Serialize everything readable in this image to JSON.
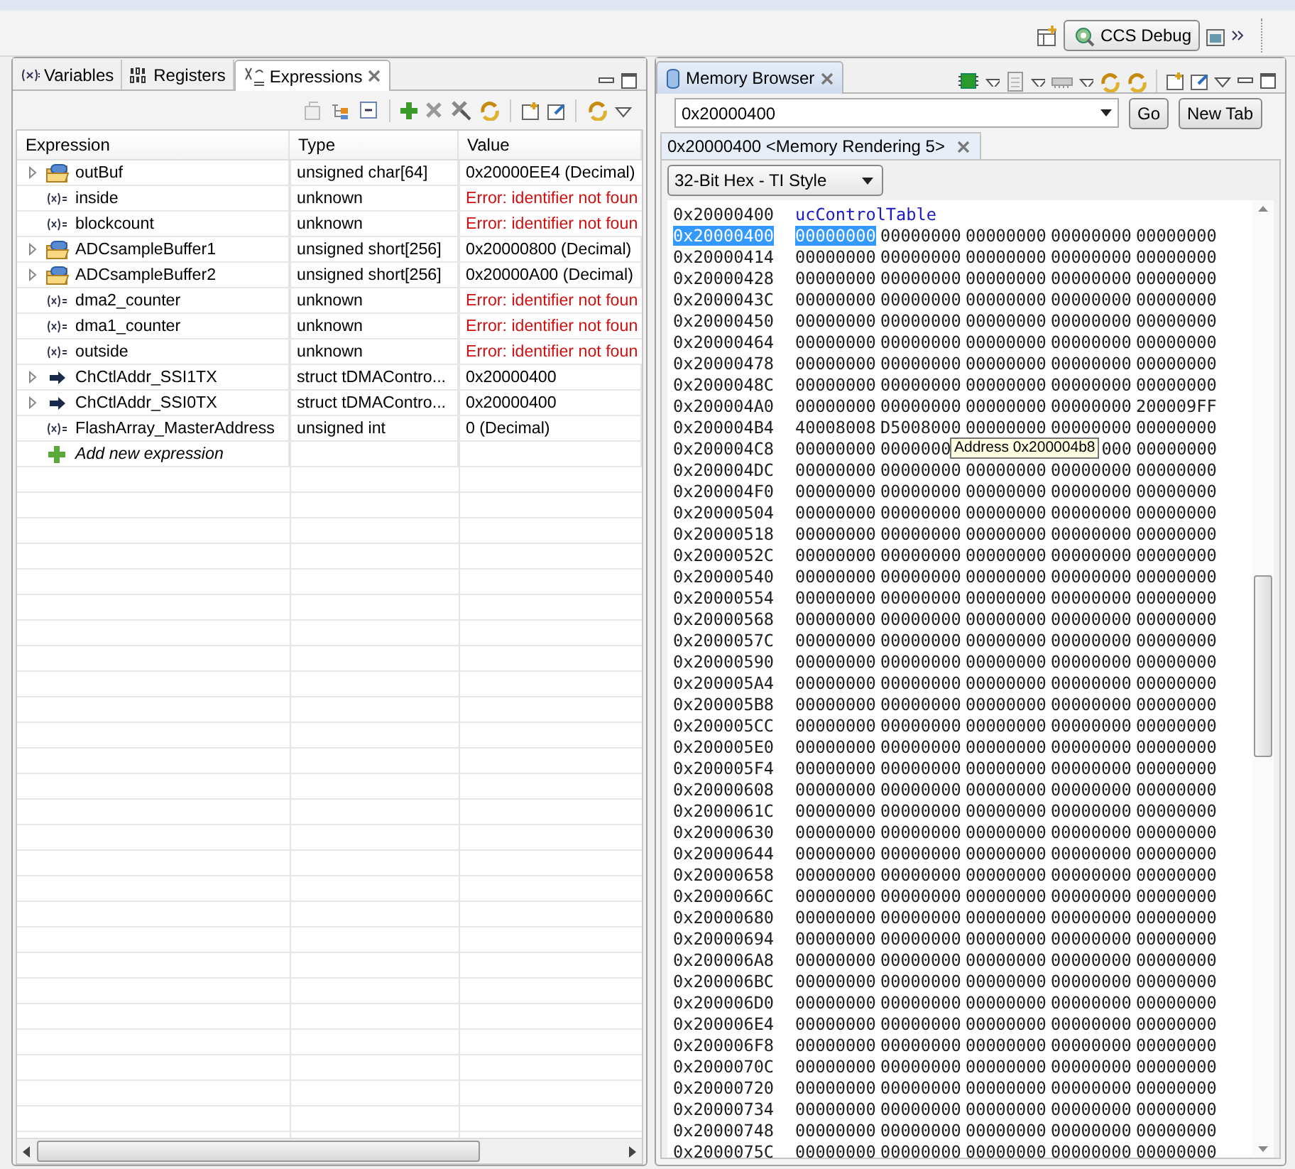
{
  "perspective_bar": {
    "perspectives": [
      {
        "label": "CCS Debug",
        "selected": true
      }
    ]
  },
  "expressions_view": {
    "tabs": [
      {
        "label": "Variables",
        "kind": "variables",
        "selected": false
      },
      {
        "label": "Registers",
        "kind": "registers",
        "selected": false
      },
      {
        "label": "Expressions",
        "kind": "expressions",
        "selected": true
      }
    ],
    "columns": [
      "Expression",
      "Type",
      "Value"
    ],
    "rows": [
      {
        "kind": "array",
        "expandable": true,
        "expression": "outBuf",
        "type": "unsigned char[64]",
        "value": "0x20000EE4 (Decimal)",
        "error": false
      },
      {
        "kind": "variable",
        "expandable": false,
        "expression": "inside",
        "type": "unknown",
        "value": "Error: identifier not foun",
        "error": true
      },
      {
        "kind": "variable",
        "expandable": false,
        "expression": "blockcount",
        "type": "unknown",
        "value": "Error: identifier not foun",
        "error": true
      },
      {
        "kind": "array",
        "expandable": true,
        "expression": "ADCsampleBuffer1",
        "type": "unsigned short[256]",
        "value": "0x20000800 (Decimal)",
        "error": false
      },
      {
        "kind": "array",
        "expandable": true,
        "expression": "ADCsampleBuffer2",
        "type": "unsigned short[256]",
        "value": "0x20000A00 (Decimal)",
        "error": false
      },
      {
        "kind": "variable",
        "expandable": false,
        "expression": "dma2_counter",
        "type": "unknown",
        "value": "Error: identifier not foun",
        "error": true
      },
      {
        "kind": "variable",
        "expandable": false,
        "expression": "dma1_counter",
        "type": "unknown",
        "value": "Error: identifier not foun",
        "error": true
      },
      {
        "kind": "variable",
        "expandable": false,
        "expression": "outside",
        "type": "unknown",
        "value": "Error: identifier not foun",
        "error": true
      },
      {
        "kind": "pointer",
        "expandable": true,
        "expression": "ChCtlAddr_SSI1TX",
        "type": "struct tDMAContro...",
        "value": "0x20000400",
        "error": false
      },
      {
        "kind": "pointer",
        "expandable": true,
        "expression": "ChCtlAddr_SSI0TX",
        "type": "struct tDMAContro...",
        "value": "0x20000400",
        "error": false
      },
      {
        "kind": "variable",
        "expandable": false,
        "expression": "FlashArray_MasterAddress",
        "type": "unsigned int",
        "value": "0 (Decimal)",
        "error": false
      },
      {
        "kind": "add",
        "expandable": false,
        "expression": "Add new expression"
      }
    ]
  },
  "memory_browser": {
    "tab": {
      "label": "Memory Browser",
      "selected": true
    },
    "address": "0x20000400",
    "go": "Go",
    "new_tab": "New Tab",
    "rendering_tab": "0x20000400 <Memory Rendering 5>",
    "format": "32-Bit Hex - TI Style",
    "label_row": {
      "address": "0x20000400",
      "symbol": "ucControlTable"
    },
    "rows": [
      {
        "address": "0x20000400",
        "selected": true,
        "words": [
          "00000000",
          "00000000",
          "00000000",
          "00000000",
          "00000000"
        ]
      },
      {
        "address": "0x20000414",
        "selected": false,
        "words": [
          "00000000",
          "00000000",
          "00000000",
          "00000000",
          "00000000"
        ]
      },
      {
        "address": "0x20000428",
        "selected": false,
        "words": [
          "00000000",
          "00000000",
          "00000000",
          "00000000",
          "00000000"
        ]
      },
      {
        "address": "0x2000043C",
        "selected": false,
        "words": [
          "00000000",
          "00000000",
          "00000000",
          "00000000",
          "00000000"
        ]
      },
      {
        "address": "0x20000450",
        "selected": false,
        "words": [
          "00000000",
          "00000000",
          "00000000",
          "00000000",
          "00000000"
        ]
      },
      {
        "address": "0x20000464",
        "selected": false,
        "words": [
          "00000000",
          "00000000",
          "00000000",
          "00000000",
          "00000000"
        ]
      },
      {
        "address": "0x20000478",
        "selected": false,
        "words": [
          "00000000",
          "00000000",
          "00000000",
          "00000000",
          "00000000"
        ]
      },
      {
        "address": "0x2000048C",
        "selected": false,
        "words": [
          "00000000",
          "00000000",
          "00000000",
          "00000000",
          "00000000"
        ]
      },
      {
        "address": "0x200004A0",
        "selected": false,
        "words": [
          "00000000",
          "00000000",
          "00000000",
          "00000000",
          "200009FF"
        ]
      },
      {
        "address": "0x200004B4",
        "selected": false,
        "words": [
          "40008008",
          "D5008000",
          "00000000",
          "00000000",
          "00000000"
        ]
      },
      {
        "address": "0x200004C8",
        "selected": false,
        "words": [
          "00000000",
          "0000000"
        ],
        "words_after_tooltip": [
          "000",
          "00000000"
        ]
      },
      {
        "address": "0x200004DC",
        "selected": false,
        "words": [
          "00000000",
          "00000000",
          "00000000",
          "00000000",
          "00000000"
        ]
      },
      {
        "address": "0x200004F0",
        "selected": false,
        "words": [
          "00000000",
          "00000000",
          "00000000",
          "00000000",
          "00000000"
        ]
      },
      {
        "address": "0x20000504",
        "selected": false,
        "words": [
          "00000000",
          "00000000",
          "00000000",
          "00000000",
          "00000000"
        ]
      },
      {
        "address": "0x20000518",
        "selected": false,
        "words": [
          "00000000",
          "00000000",
          "00000000",
          "00000000",
          "00000000"
        ]
      },
      {
        "address": "0x2000052C",
        "selected": false,
        "words": [
          "00000000",
          "00000000",
          "00000000",
          "00000000",
          "00000000"
        ]
      },
      {
        "address": "0x20000540",
        "selected": false,
        "words": [
          "00000000",
          "00000000",
          "00000000",
          "00000000",
          "00000000"
        ]
      },
      {
        "address": "0x20000554",
        "selected": false,
        "words": [
          "00000000",
          "00000000",
          "00000000",
          "00000000",
          "00000000"
        ]
      },
      {
        "address": "0x20000568",
        "selected": false,
        "words": [
          "00000000",
          "00000000",
          "00000000",
          "00000000",
          "00000000"
        ]
      },
      {
        "address": "0x2000057C",
        "selected": false,
        "words": [
          "00000000",
          "00000000",
          "00000000",
          "00000000",
          "00000000"
        ]
      },
      {
        "address": "0x20000590",
        "selected": false,
        "words": [
          "00000000",
          "00000000",
          "00000000",
          "00000000",
          "00000000"
        ]
      },
      {
        "address": "0x200005A4",
        "selected": false,
        "words": [
          "00000000",
          "00000000",
          "00000000",
          "00000000",
          "00000000"
        ]
      },
      {
        "address": "0x200005B8",
        "selected": false,
        "words": [
          "00000000",
          "00000000",
          "00000000",
          "00000000",
          "00000000"
        ]
      },
      {
        "address": "0x200005CC",
        "selected": false,
        "words": [
          "00000000",
          "00000000",
          "00000000",
          "00000000",
          "00000000"
        ]
      },
      {
        "address": "0x200005E0",
        "selected": false,
        "words": [
          "00000000",
          "00000000",
          "00000000",
          "00000000",
          "00000000"
        ]
      },
      {
        "address": "0x200005F4",
        "selected": false,
        "words": [
          "00000000",
          "00000000",
          "00000000",
          "00000000",
          "00000000"
        ]
      },
      {
        "address": "0x20000608",
        "selected": false,
        "words": [
          "00000000",
          "00000000",
          "00000000",
          "00000000",
          "00000000"
        ]
      },
      {
        "address": "0x2000061C",
        "selected": false,
        "words": [
          "00000000",
          "00000000",
          "00000000",
          "00000000",
          "00000000"
        ]
      },
      {
        "address": "0x20000630",
        "selected": false,
        "words": [
          "00000000",
          "00000000",
          "00000000",
          "00000000",
          "00000000"
        ]
      },
      {
        "address": "0x20000644",
        "selected": false,
        "words": [
          "00000000",
          "00000000",
          "00000000",
          "00000000",
          "00000000"
        ]
      },
      {
        "address": "0x20000658",
        "selected": false,
        "words": [
          "00000000",
          "00000000",
          "00000000",
          "00000000",
          "00000000"
        ]
      },
      {
        "address": "0x2000066C",
        "selected": false,
        "words": [
          "00000000",
          "00000000",
          "00000000",
          "00000000",
          "00000000"
        ]
      },
      {
        "address": "0x20000680",
        "selected": false,
        "words": [
          "00000000",
          "00000000",
          "00000000",
          "00000000",
          "00000000"
        ]
      },
      {
        "address": "0x20000694",
        "selected": false,
        "words": [
          "00000000",
          "00000000",
          "00000000",
          "00000000",
          "00000000"
        ]
      },
      {
        "address": "0x200006A8",
        "selected": false,
        "words": [
          "00000000",
          "00000000",
          "00000000",
          "00000000",
          "00000000"
        ]
      },
      {
        "address": "0x200006BC",
        "selected": false,
        "words": [
          "00000000",
          "00000000",
          "00000000",
          "00000000",
          "00000000"
        ]
      },
      {
        "address": "0x200006D0",
        "selected": false,
        "words": [
          "00000000",
          "00000000",
          "00000000",
          "00000000",
          "00000000"
        ]
      },
      {
        "address": "0x200006E4",
        "selected": false,
        "words": [
          "00000000",
          "00000000",
          "00000000",
          "00000000",
          "00000000"
        ]
      },
      {
        "address": "0x200006F8",
        "selected": false,
        "words": [
          "00000000",
          "00000000",
          "00000000",
          "00000000",
          "00000000"
        ]
      },
      {
        "address": "0x2000070C",
        "selected": false,
        "words": [
          "00000000",
          "00000000",
          "00000000",
          "00000000",
          "00000000"
        ]
      },
      {
        "address": "0x20000720",
        "selected": false,
        "words": [
          "00000000",
          "00000000",
          "00000000",
          "00000000",
          "00000000"
        ]
      },
      {
        "address": "0x20000734",
        "selected": false,
        "words": [
          "00000000",
          "00000000",
          "00000000",
          "00000000",
          "00000000"
        ]
      },
      {
        "address": "0x20000748",
        "selected": false,
        "words": [
          "00000000",
          "00000000",
          "00000000",
          "00000000",
          "00000000"
        ]
      },
      {
        "address": "0x2000075C",
        "selected": false,
        "words": [
          "00000000",
          "00000000",
          "00000000",
          "00000000",
          "00000000"
        ]
      }
    ],
    "tooltip": "Address 0x200004b8"
  }
}
